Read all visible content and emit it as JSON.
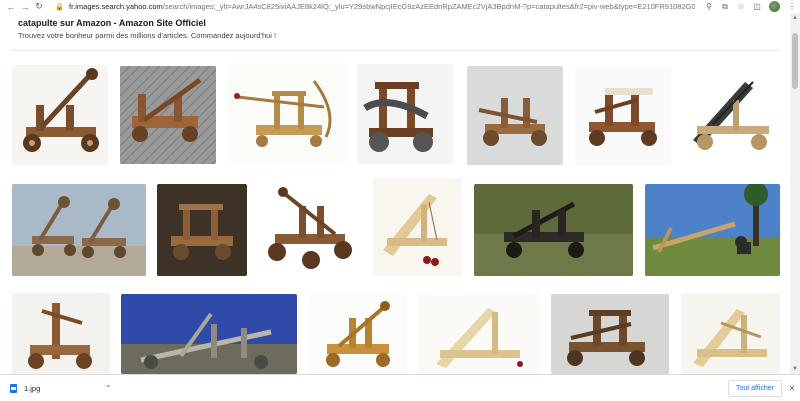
{
  "browser": {
    "url_host": "fr.images.search.yahoo.com",
    "url_rest": "/search/images;_ylt=AwrJA4sC825iviAAJE8k24lQ;_ylu=Y29sbwNpcjIEcG9zAzEEdnRpZAMEc2VjA3BpdnM-?p=catapultes&fr2=piv-web&type=E210FR91082G0&fr=...",
    "back_icon": "back-arrow-icon",
    "forward_icon": "forward-arrow-icon",
    "reload_icon": "reload-icon"
  },
  "ad": {
    "title": "catapulte sur Amazon - Amazon Site Officiel",
    "description": "Trouvez votre bonheur parmi des millions d'articles. Commandez aujourd'hui !"
  },
  "download": {
    "file_name": "1.jpg",
    "show_all_label": "Tout afficher",
    "close_symbol": "✕",
    "chevron_symbol": "⌃"
  },
  "colors": {
    "link_blue": "#1a73e8",
    "wood_light": "#d6b67a",
    "wood_dark": "#6b4426"
  }
}
